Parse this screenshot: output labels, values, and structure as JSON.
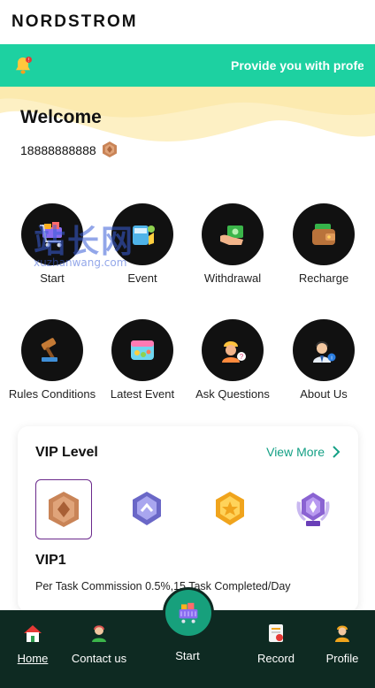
{
  "header": {
    "brand": "NORDSTROM"
  },
  "notice": {
    "text": "Provide you with profe"
  },
  "welcome": {
    "title": "Welcome",
    "phone": "18888888888"
  },
  "menu": [
    {
      "label": "Start",
      "icon": "shopping-cart-icon"
    },
    {
      "label": "Event",
      "icon": "gift-icon"
    },
    {
      "label": "Withdrawal",
      "icon": "cash-hand-icon"
    },
    {
      "label": "Recharge",
      "icon": "wallet-icon"
    },
    {
      "label": "Rules Conditions",
      "icon": "gavel-icon"
    },
    {
      "label": "Latest Event",
      "icon": "calendar-icon"
    },
    {
      "label": "Ask Questions",
      "icon": "worker-question-icon"
    },
    {
      "label": "About Us",
      "icon": "support-agent-icon"
    }
  ],
  "watermark": {
    "cn": "站长网",
    "en": "xuzhanwang.com"
  },
  "vip": {
    "title": "VIP Level",
    "more": "View More",
    "current": "VIP1",
    "description": "Per Task Commission 0.5%,15 Task Completed/Day",
    "badges": [
      "bronze-badge-icon",
      "silver-badge-icon",
      "gold-badge-icon",
      "diamond-badge-icon"
    ]
  },
  "nav": {
    "home": "Home",
    "contact": "Contact us",
    "start": "Start",
    "record": "Record",
    "profile": "Profile"
  }
}
